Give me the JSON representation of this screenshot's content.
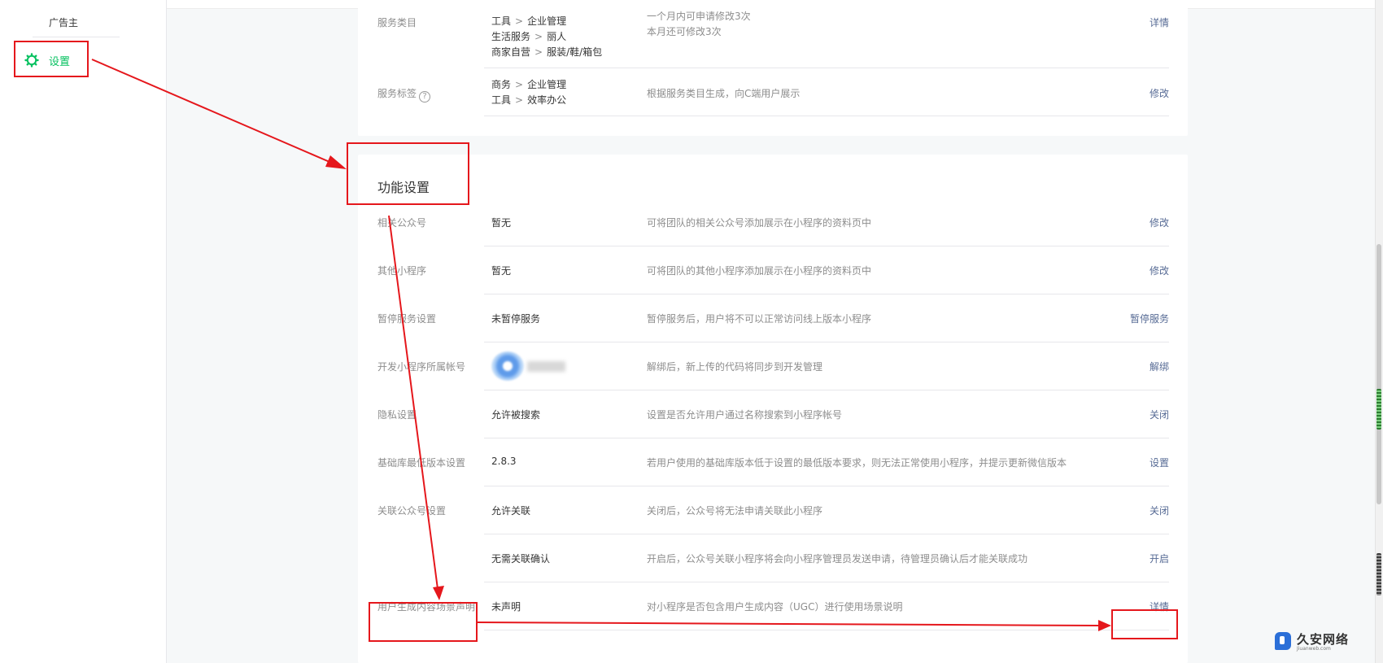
{
  "sidebar": {
    "ad_label": "广告主",
    "settings_label": "设置"
  },
  "service_panel": {
    "category": {
      "label": "服务类目",
      "values": [
        {
          "parent": "工具",
          "child": "企业管理"
        },
        {
          "parent": "生活服务",
          "child": "丽人"
        },
        {
          "parent": "商家自营",
          "child": "服装/鞋/箱包"
        }
      ],
      "desc_lines": [
        "一个月内可申请修改3次",
        "本月还可修改3次"
      ],
      "action": "详情"
    },
    "tags": {
      "label": "服务标签",
      "help_icon": "?",
      "values": [
        {
          "parent": "商务",
          "child": "企业管理"
        },
        {
          "parent": "工具",
          "child": "效率办公"
        }
      ],
      "desc": "根据服务类目生成，向C端用户展示",
      "action": "修改"
    }
  },
  "function_settings": {
    "title": "功能设置",
    "rows": [
      {
        "label": "相关公众号",
        "value": "暂无",
        "desc": "可将团队的相关公众号添加展示在小程序的资料页中",
        "action": "修改"
      },
      {
        "label": "其他小程序",
        "value": "暂无",
        "desc": "可将团队的其他小程序添加展示在小程序的资料页中",
        "action": "修改"
      },
      {
        "label": "暂停服务设置",
        "value": "未暂停服务",
        "desc": "暂停服务后，用户将不可以正常访问线上版本小程序",
        "action": "暂停服务"
      },
      {
        "label": "开发小程序所属帐号",
        "value": "",
        "desc": "解绑后，新上传的代码将同步到开发管理",
        "action": "解绑"
      },
      {
        "label": "隐私设置",
        "value": "允许被搜索",
        "desc": "设置是否允许用户通过名称搜索到小程序帐号",
        "action": "关闭"
      },
      {
        "label": "基础库最低版本设置",
        "value": "2.8.3",
        "desc": "若用户使用的基础库版本低于设置的最低版本要求，则无法正常使用小程序，并提示更新微信版本",
        "action": "设置"
      },
      {
        "label": "关联公众号设置",
        "value": "允许关联",
        "desc": "关闭后，公众号将无法申请关联此小程序",
        "action": "关闭"
      },
      {
        "label": "",
        "value": "无需关联确认",
        "desc": "开启后，公众号关联小程序将会向小程序管理员发送申请，待管理员确认后才能关联成功",
        "action": "开启"
      },
      {
        "label": "用户生成内容场景声明",
        "value": "未声明",
        "desc": "对小程序是否包含用户生成内容（UGC）进行使用场景说明",
        "action": "详情"
      }
    ]
  },
  "watermark": {
    "title": "久安网络",
    "subtitle": "Jiuanweb.com"
  },
  "colors": {
    "accent_green": "#07c160",
    "link_blue": "#576b95",
    "annotation_red": "#e5171c"
  }
}
